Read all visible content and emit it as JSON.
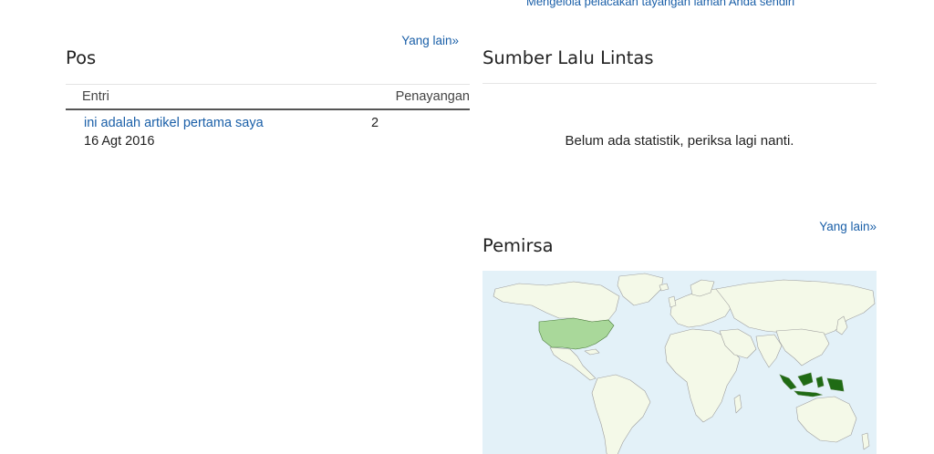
{
  "top_link": "Mengelola pelacakan tayangan laman Anda sendiri",
  "pos": {
    "more_link": "Yang lain»",
    "title": "Pos",
    "columns": {
      "entry": "Entri",
      "views": "Penayangan"
    },
    "rows": [
      {
        "title": "ini adalah artikel pertama saya",
        "date": "16 Agt 2016",
        "views": "2"
      }
    ]
  },
  "traffic": {
    "title": "Sumber Lalu Lintas",
    "empty_message": "Belum ada statistik, periksa lagi nanti."
  },
  "audience": {
    "more_link": "Yang lain»",
    "title": "Pemirsa",
    "map": {
      "ocean_color": "#e3f1f8",
      "land_color": "#f4f9e8",
      "border_color": "#9e9e9e",
      "highlighted": [
        {
          "country": "Indonesia",
          "color": "#1f6b14"
        },
        {
          "country": "United States",
          "color": "#a9d89a"
        }
      ]
    }
  }
}
